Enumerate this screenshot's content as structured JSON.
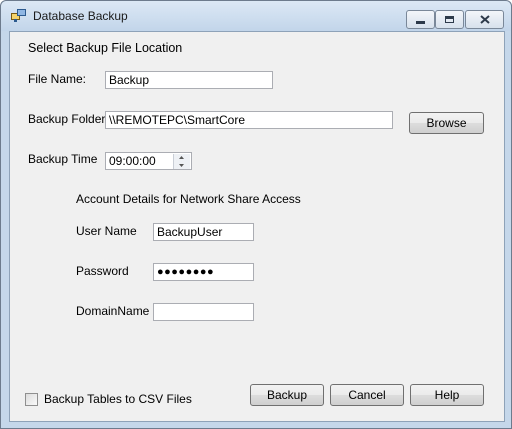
{
  "window": {
    "title": "Database Backup",
    "icons": {
      "app": "database-icon",
      "minimize": "minimize-icon",
      "maximize": "maximize-icon",
      "close": "close-icon"
    }
  },
  "form": {
    "heading": "Select Backup File Location",
    "file_name_label": "File Name:",
    "file_name_value": "Backup",
    "backup_folder_label": "Backup Folder:",
    "backup_folder_value": "\\\\REMOTEPC\\SmartCore",
    "browse_label": "Browse",
    "backup_time_label": "Backup Time",
    "backup_time_value": "09:00:00",
    "account_heading": "Account Details for Network Share Access",
    "user_name_label": "User Name",
    "user_name_value": "BackupUser",
    "password_label": "Password",
    "password_value": "●●●●●●●●",
    "domain_label": "DomainName",
    "domain_value": ""
  },
  "footer": {
    "csv_checkbox_label": "Backup Tables to CSV Files",
    "csv_checked": false,
    "backup_button": "Backup",
    "cancel_button": "Cancel",
    "help_button": "Help"
  }
}
